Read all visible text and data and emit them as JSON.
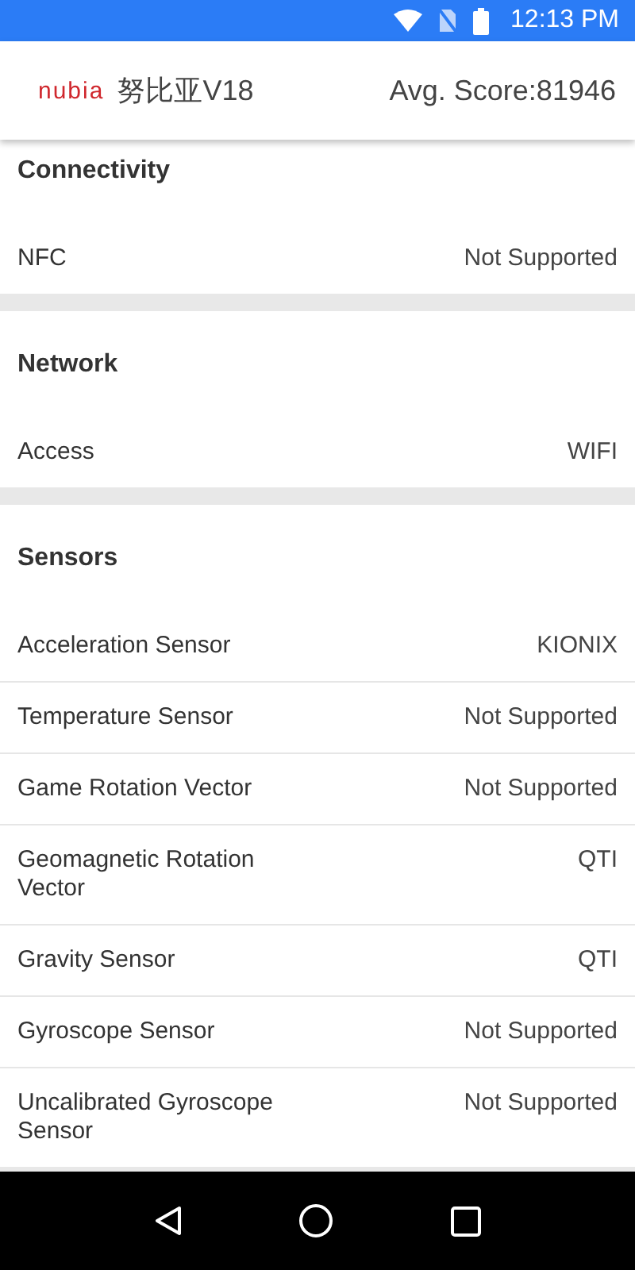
{
  "status_bar": {
    "time": "12:13 PM"
  },
  "header": {
    "logo": "nubia",
    "title": "努比亚V18",
    "score": "Avg. Score:81946"
  },
  "sections": [
    {
      "title": "Connectivity",
      "rows": [
        {
          "label": "NFC",
          "value": "Not Supported"
        }
      ]
    },
    {
      "title": "Network",
      "rows": [
        {
          "label": "Access",
          "value": "WIFI"
        }
      ]
    },
    {
      "title": "Sensors",
      "rows": [
        {
          "label": "Acceleration Sensor",
          "value": "KIONIX"
        },
        {
          "label": "Temperature Sensor",
          "value": "Not Supported"
        },
        {
          "label": "Game Rotation Vector",
          "value": "Not Supported"
        },
        {
          "label": "Geomagnetic Rotation Vector",
          "value": "QTI"
        },
        {
          "label": "Gravity Sensor",
          "value": "QTI"
        },
        {
          "label": "Gyroscope Sensor",
          "value": "Not Supported"
        },
        {
          "label": "Uncalibrated Gyroscope Sensor",
          "value": "Not Supported"
        }
      ]
    }
  ]
}
